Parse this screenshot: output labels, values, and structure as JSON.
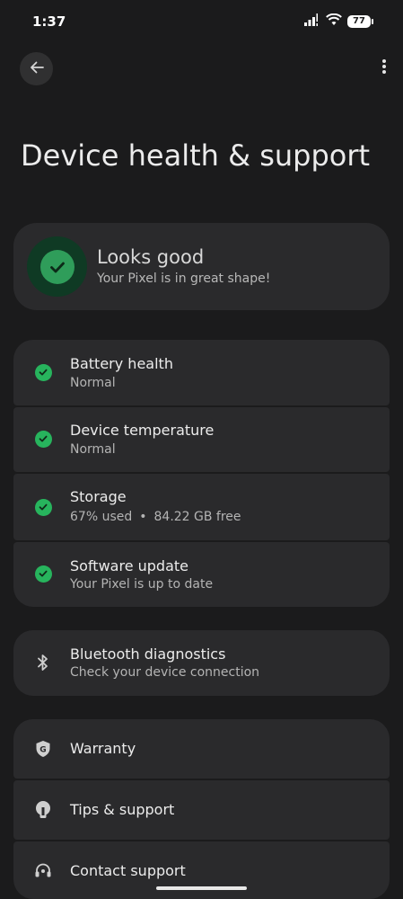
{
  "status_bar": {
    "time": "1:37",
    "battery": "77"
  },
  "header": {
    "title": "Device health & support"
  },
  "summary": {
    "title": "Looks good",
    "subtitle": "Your Pixel is in great shape!"
  },
  "checks": [
    {
      "title": "Battery health",
      "subtitle": "Normal"
    },
    {
      "title": "Device temperature",
      "subtitle": "Normal"
    },
    {
      "title": "Storage",
      "subtitle_used": "67% used",
      "subtitle_sep": "•",
      "subtitle_free": "84.22 GB free"
    },
    {
      "title": "Software update",
      "subtitle": "Your Pixel is up to date"
    }
  ],
  "bluetooth": {
    "title": "Bluetooth diagnostics",
    "subtitle": "Check your device connection"
  },
  "support": [
    {
      "title": "Warranty",
      "icon": "warranty-shield-icon"
    },
    {
      "title": "Tips & support",
      "icon": "lightbulb-icon"
    },
    {
      "title": "Contact support",
      "icon": "headset-icon"
    }
  ],
  "colors": {
    "background": "#1b1b1c",
    "card": "#2a2a2c",
    "check_green": "#27b45d",
    "summary_ring": "#0f3a24"
  }
}
